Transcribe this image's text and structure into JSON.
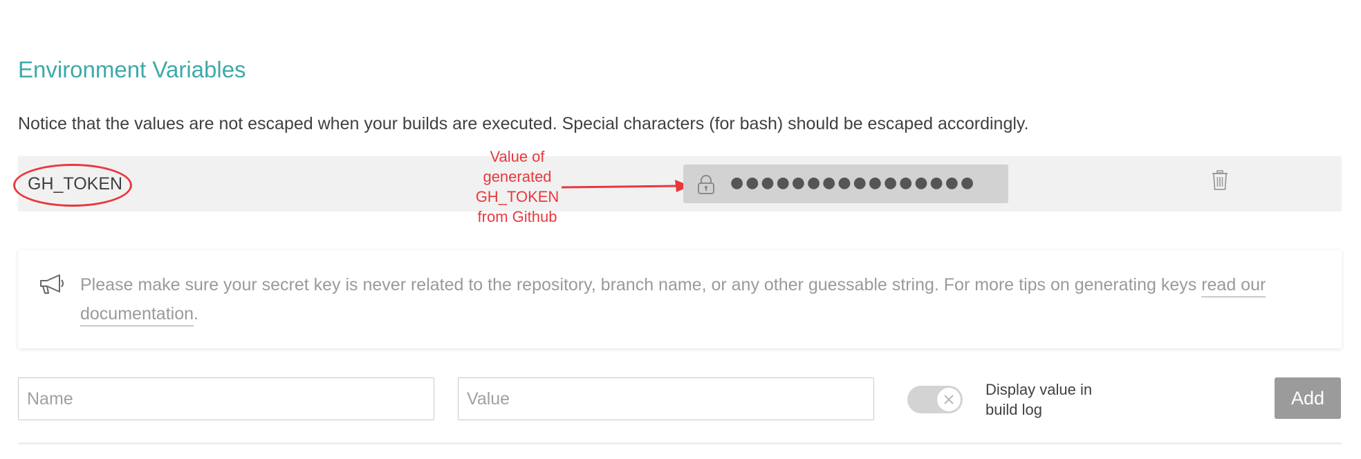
{
  "section": {
    "title": "Environment Variables",
    "notice": "Notice that the values are not escaped when your builds are executed. Special characters (for bash) should be escaped accordingly."
  },
  "env_vars": [
    {
      "name": "GH_TOKEN",
      "value_masked": "●●●●●●●●●●●●●●●●",
      "icon": "lock-icon",
      "delete_icon": "trash-icon"
    }
  ],
  "annotation": {
    "lines": [
      "Value of",
      "generated",
      "GH_TOKEN",
      "from Github"
    ],
    "color": "#e8383d"
  },
  "tip": {
    "icon": "megaphone-icon",
    "text": "Please make sure your secret key is never related to the repository, branch name, or any other guessable string. For more tips on generating keys ",
    "link_text": "read our documentation",
    "suffix": "."
  },
  "form": {
    "name_placeholder": "Name",
    "value_placeholder": "Value",
    "toggle_label": "Display value in build log",
    "toggle_state": "off",
    "add_label": "Add"
  },
  "colors": {
    "accent": "#3ea9a9",
    "annotation": "#e8383d",
    "button": "#9b9b9b"
  }
}
